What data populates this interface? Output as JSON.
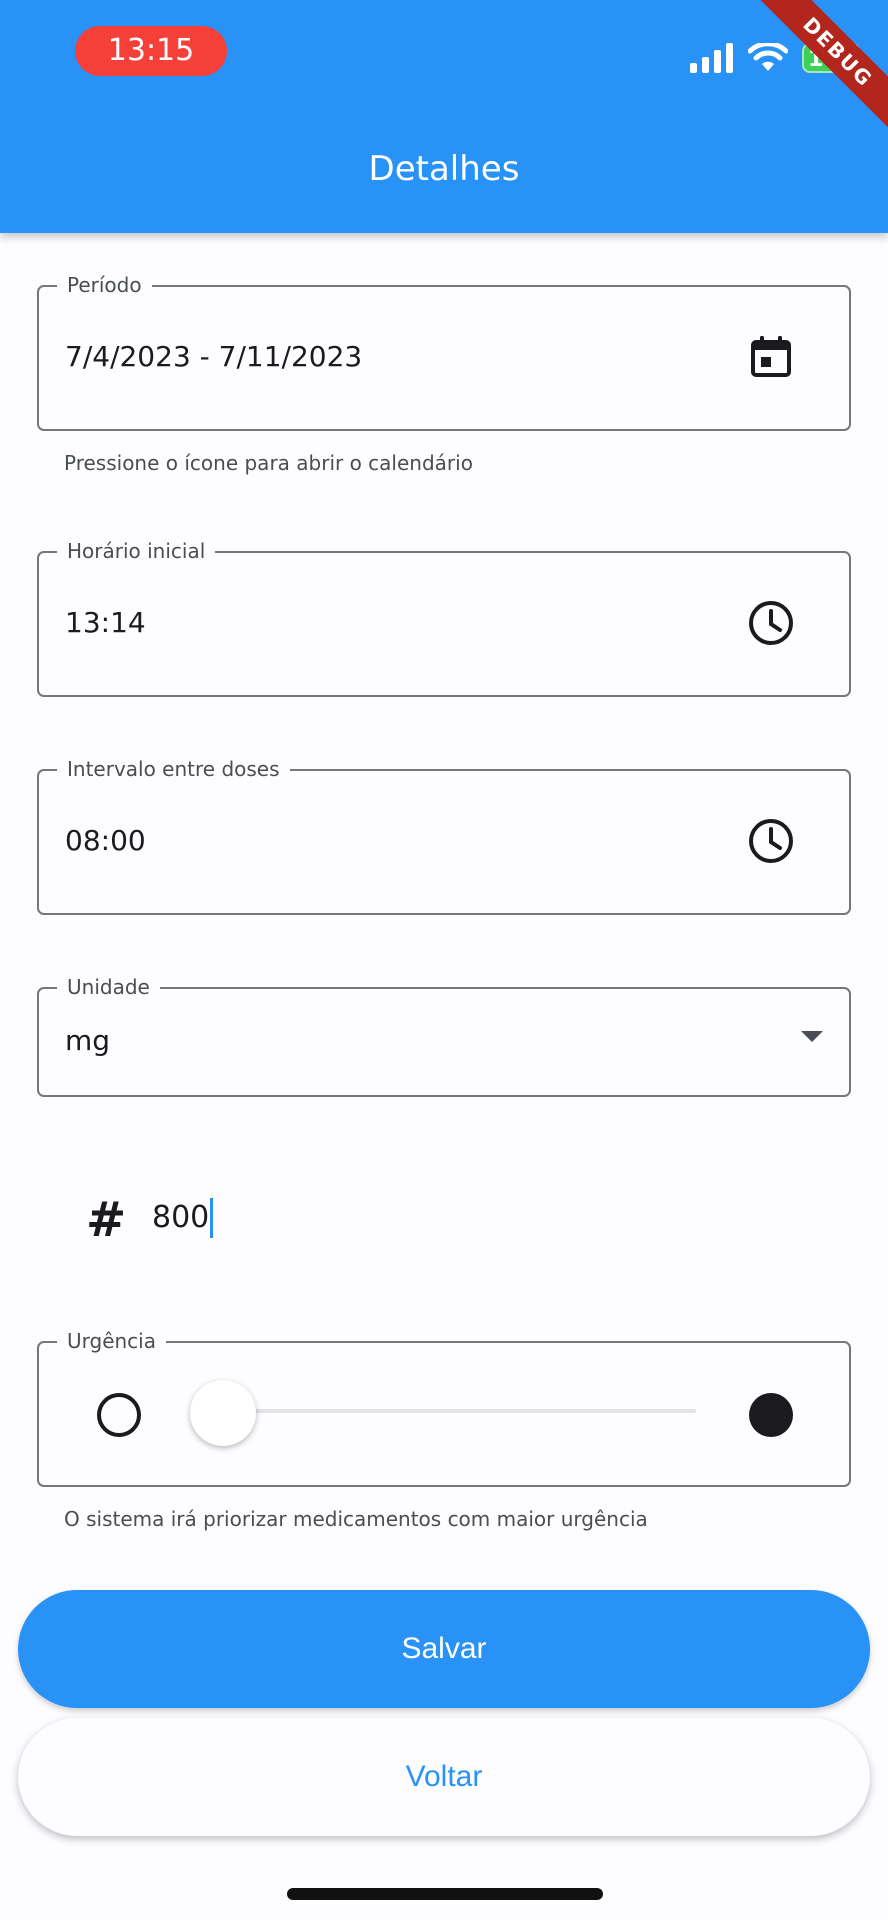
{
  "status_bar": {
    "time": "13:15",
    "battery": "100",
    "debug_ribbon": "DEBUG"
  },
  "app_bar": {
    "title": "Detalhes"
  },
  "period": {
    "label": "Período",
    "value": "7/4/2023 - 7/11/2023",
    "helper": "Pressione o ícone para abrir o calendário",
    "icon": "calendar-icon"
  },
  "start_time": {
    "label": "Horário inicial",
    "value": "13:14",
    "icon": "clock-icon"
  },
  "interval": {
    "label": "Intervalo entre doses",
    "value": "08:00",
    "icon": "clock-icon"
  },
  "unit": {
    "label": "Unidade",
    "value": "mg",
    "icon": "dropdown-arrow-icon"
  },
  "dose": {
    "prefix_icon": "hash-icon",
    "value": "800"
  },
  "urgency": {
    "label": "Urgência",
    "helper": "O sistema irá priorizar medicamentos com maior urgência",
    "slider_value": 0,
    "min_icon": "circle-outline-icon",
    "max_icon": "circle-filled-icon"
  },
  "buttons": {
    "save": "Salvar",
    "back": "Voltar"
  },
  "colors": {
    "primary": "#2892f7",
    "status_pill": "#f5403a",
    "debug_ribbon": "#b3261e"
  }
}
